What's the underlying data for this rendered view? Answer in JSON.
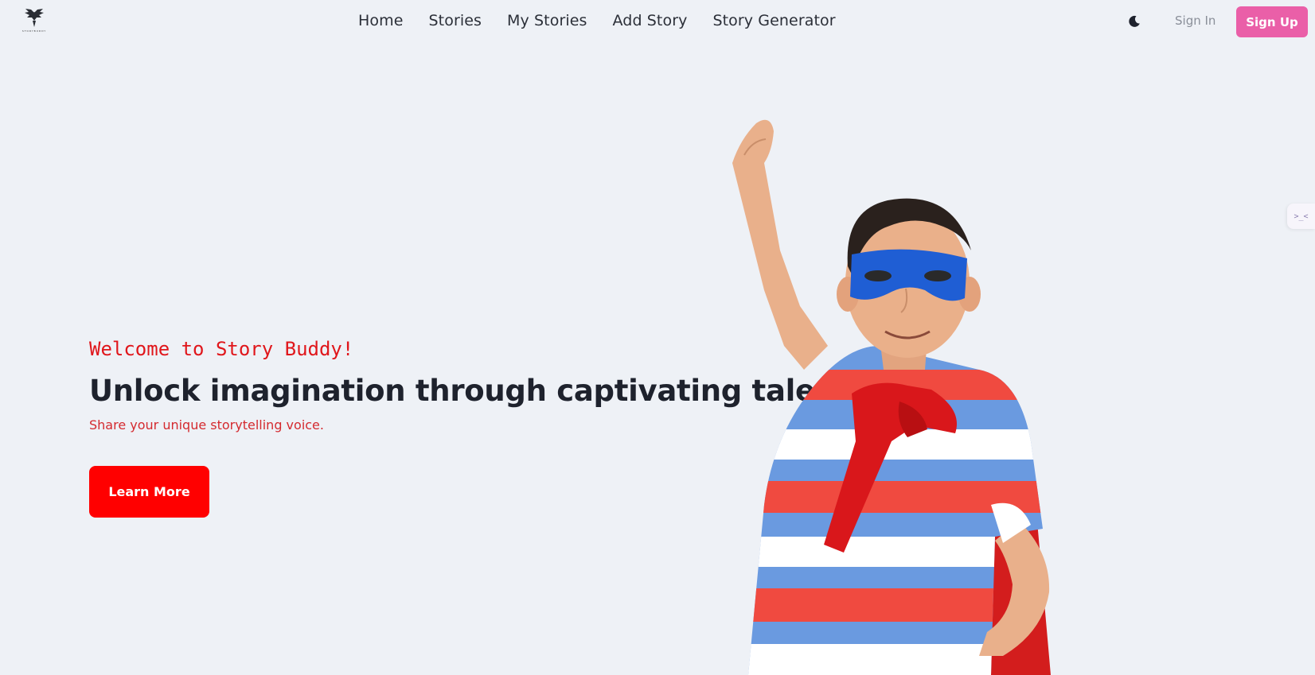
{
  "nav": {
    "logo_text": "STORYBUDDY",
    "links": [
      "Home",
      "Stories",
      "My Stories",
      "Add Story",
      "Story Generator"
    ],
    "theme_icon": "moon-icon",
    "sign_in": "Sign In",
    "sign_up": "Sign Up"
  },
  "side_tab": {
    "label": ">_<"
  },
  "hero": {
    "welcome": "Welcome to Story Buddy!",
    "title": "Unlock imagination through captivating tales.",
    "subtitle": "Share your unique storytelling voice.",
    "cta": "Learn More"
  },
  "colors": {
    "background": "#eef1f6",
    "accent_red": "#ff0000",
    "signup_pink": "#ea5fa8",
    "welcome_red": "#e0161b"
  }
}
